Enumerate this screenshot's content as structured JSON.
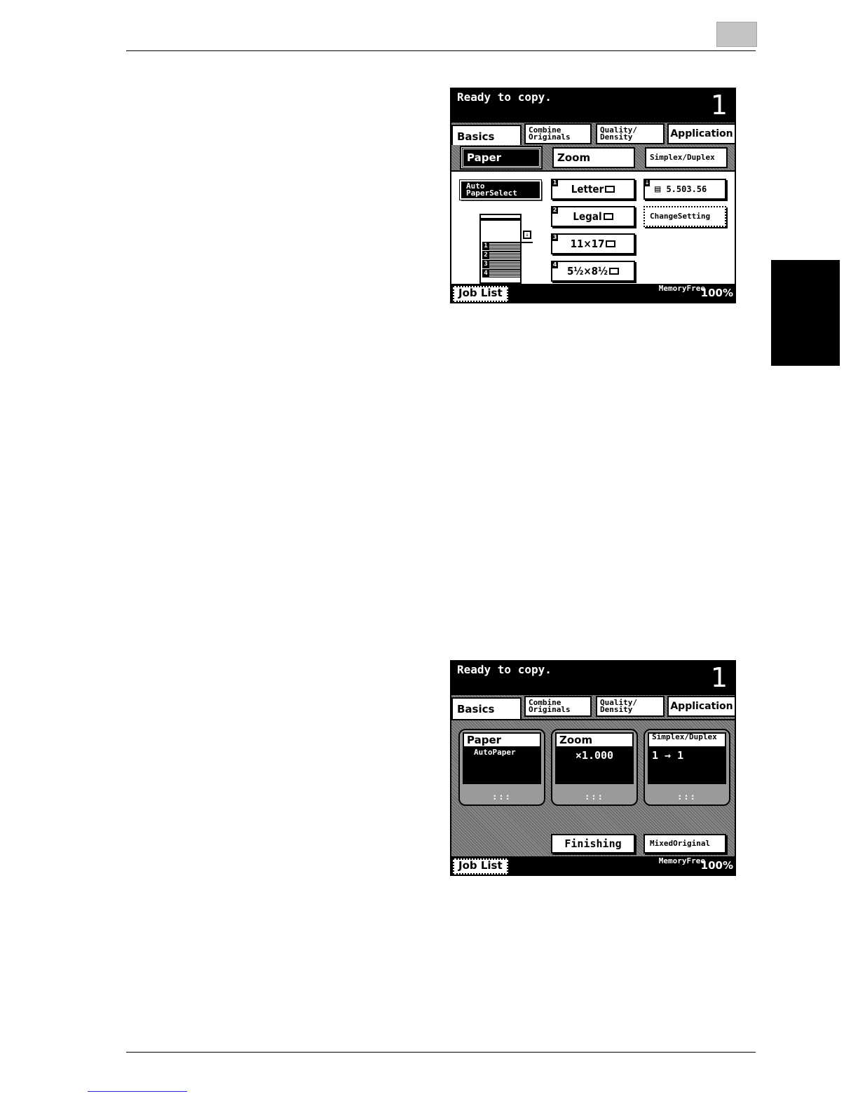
{
  "panel1": {
    "status": "Ready to copy.",
    "copies": "1",
    "tabs": {
      "basics": "Basics",
      "combine_l1": "Combine",
      "combine_l2": "Originals",
      "quality_l1": "Quality/",
      "quality_l2": "Density",
      "application": "Application"
    },
    "subtabs": {
      "paper": "Paper",
      "zoom": "Zoom",
      "simplex_l1": "Simplex/",
      "simplex_l2": "Duplex"
    },
    "auto_paper_l1": "Auto Paper",
    "auto_paper_l2": "Select",
    "trays": [
      {
        "num": "1",
        "label": "Letter"
      },
      {
        "num": "2",
        "label": "Legal"
      },
      {
        "num": "3",
        "label": "11×17"
      },
      {
        "num": "4",
        "label": "5½×8½"
      }
    ],
    "bypass": {
      "line1": "5.50",
      "line2": "3.56"
    },
    "change_setting_l1": "Change",
    "change_setting_l2": "Setting",
    "tray_labels": [
      "1",
      "2",
      "3",
      "4"
    ],
    "job_list": "Job List",
    "memory_l1": "Memory",
    "memory_l2": "Free",
    "memory_value": "100%"
  },
  "panel2": {
    "status": "Ready to copy.",
    "copies": "1",
    "tabs": {
      "basics": "Basics",
      "combine_l1": "Combine",
      "combine_l2": "Originals",
      "quality_l1": "Quality/",
      "quality_l2": "Density",
      "application": "Application"
    },
    "cards": {
      "paper_title": "Paper",
      "paper_value_l1": "Auto",
      "paper_value_l2": "Paper",
      "zoom_title": "Zoom",
      "zoom_value": "×1.000",
      "simplex_title_l1": "Simplex/",
      "simplex_title_l2": "Duplex",
      "simplex_value": "1 → 1",
      "dots": ":::"
    },
    "finishing": "Finishing",
    "mixed_l1": "Mixed",
    "mixed_l2": "Original",
    "job_list": "Job List",
    "memory_l1": "Memory",
    "memory_l2": "Free",
    "memory_value": "100%"
  }
}
